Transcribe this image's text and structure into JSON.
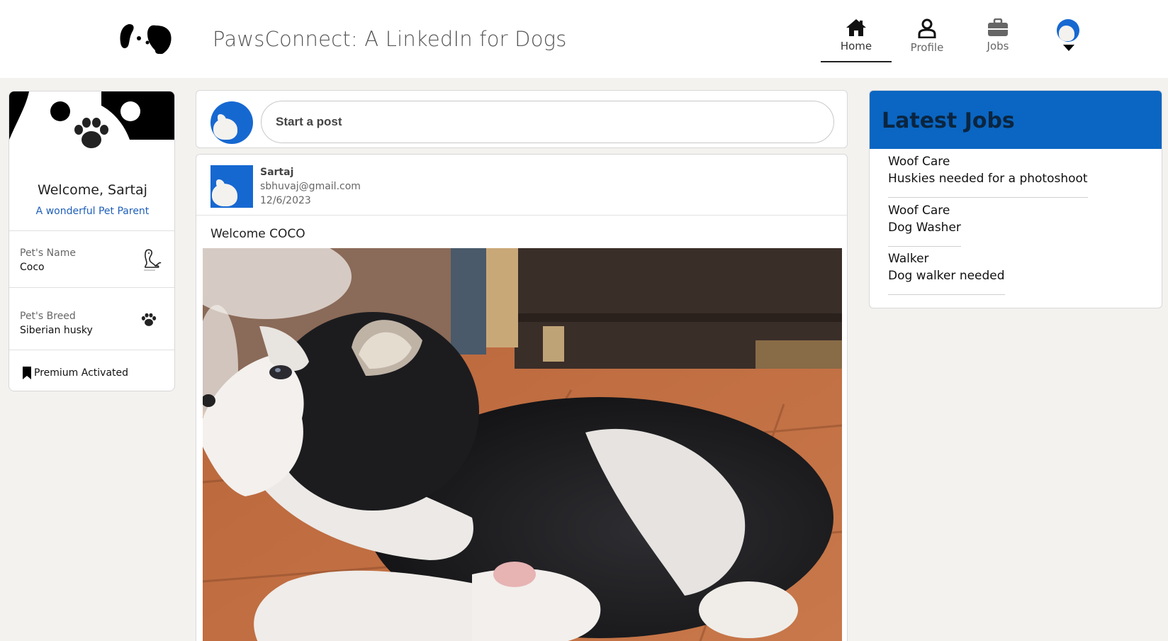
{
  "header": {
    "app_title": "PawsConnect: A LinkedIn for Dogs",
    "nav": {
      "home": "Home",
      "profile": "Profile",
      "jobs": "Jobs"
    }
  },
  "profile_card": {
    "welcome": "Welcome, Sartaj",
    "tagline": "A wonderful Pet Parent",
    "pet_name_label": "Pet's Name",
    "pet_name": "Coco",
    "pet_breed_label": "Pet's Breed",
    "pet_breed": "Siberian husky",
    "premium": "Premium Activated"
  },
  "composer": {
    "start_post": "Start a post"
  },
  "post": {
    "author": "Sartaj",
    "email": "sbhuvaj@gmail.com",
    "date": "12/6/2023",
    "text": "Welcome COCO"
  },
  "jobs": {
    "title": "Latest Jobs",
    "items": [
      {
        "company": "Woof Care",
        "role": "Huskies needed for a photoshoot"
      },
      {
        "company": "Woof Care",
        "role": "Dog Washer"
      },
      {
        "company": "Walker",
        "role": "Dog walker needed"
      }
    ]
  },
  "colors": {
    "accent": "#0a66c2",
    "background": "#f3f2ef",
    "link": "#1f5fb8"
  }
}
